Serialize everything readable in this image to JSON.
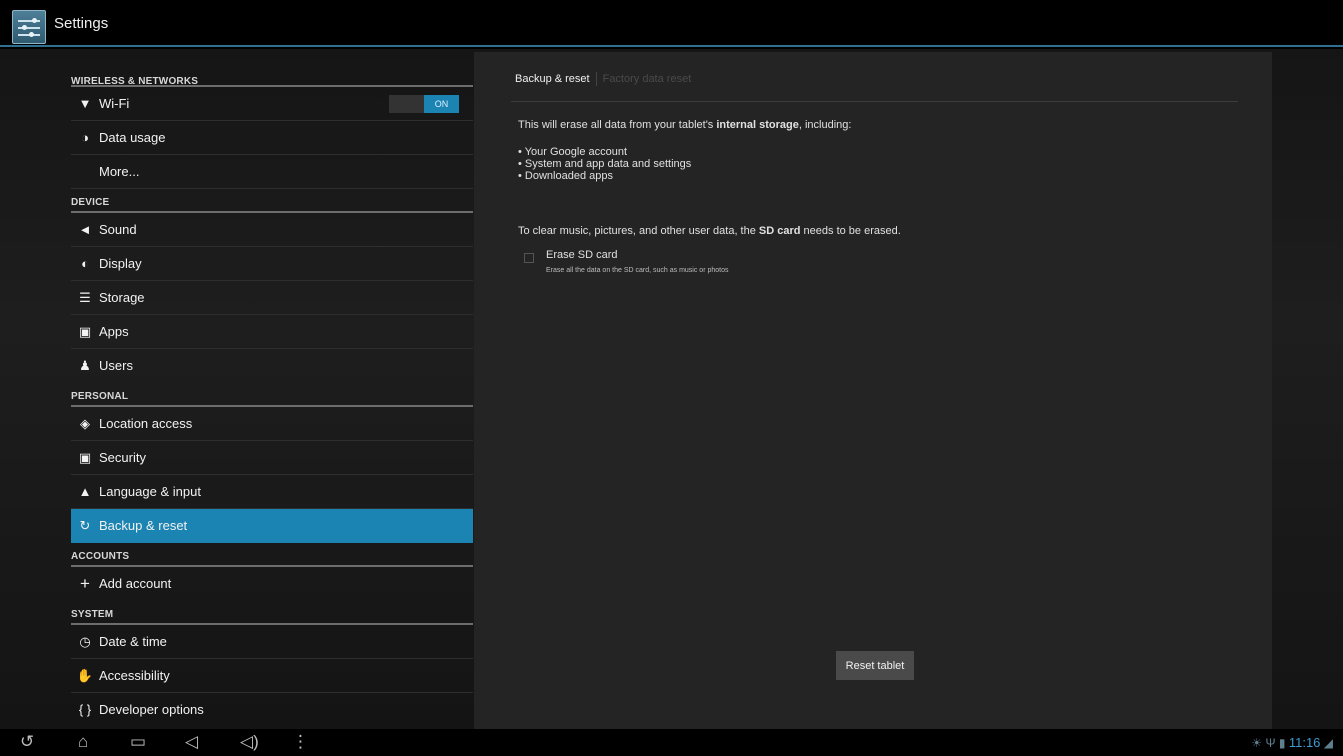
{
  "app": {
    "title": "Settings",
    "icon": "settings-sliders-icon"
  },
  "sidebar": {
    "sections": [
      {
        "header": "WIRELESS & NETWORKS",
        "items": [
          {
            "icon": "wifi-icon",
            "label": "Wi-Fi",
            "toggle": "ON"
          },
          {
            "icon": "data-usage-icon",
            "label": "Data usage"
          },
          {
            "icon": "",
            "label": "More..."
          }
        ]
      },
      {
        "header": "DEVICE",
        "items": [
          {
            "icon": "sound-icon",
            "label": "Sound"
          },
          {
            "icon": "display-icon",
            "label": "Display"
          },
          {
            "icon": "storage-icon",
            "label": "Storage"
          },
          {
            "icon": "apps-icon",
            "label": "Apps"
          },
          {
            "icon": "users-icon",
            "label": "Users"
          }
        ]
      },
      {
        "header": "PERSONAL",
        "items": [
          {
            "icon": "location-icon",
            "label": "Location access"
          },
          {
            "icon": "lock-icon",
            "label": "Security"
          },
          {
            "icon": "language-icon",
            "label": "Language & input"
          },
          {
            "icon": "backup-icon",
            "label": "Backup & reset",
            "selected": true
          }
        ]
      },
      {
        "header": "ACCOUNTS",
        "items": [
          {
            "icon": "add-icon",
            "label": "Add account"
          }
        ]
      },
      {
        "header": "SYSTEM",
        "items": [
          {
            "icon": "clock-icon",
            "label": "Date & time"
          },
          {
            "icon": "hand-icon",
            "label": "Accessibility"
          },
          {
            "icon": "braces-icon",
            "label": "Developer options"
          }
        ]
      }
    ]
  },
  "panel": {
    "breadcrumb": {
      "active": "Backup & reset",
      "inactive": "Factory data reset"
    },
    "description": {
      "before": "This will erase all data from your tablet's ",
      "bold": "internal storage",
      "after": ", including:"
    },
    "list": [
      "Your Google account",
      "System and app data and settings",
      "Downloaded apps"
    ],
    "sd_note": {
      "before": "To clear music, pictures, and other user data, the ",
      "bold": "SD card",
      "after": " needs to be erased."
    },
    "checkbox": {
      "label": "Erase SD card",
      "sublabel": "Erase all the data on the SD card, such as music or photos",
      "checked": false
    },
    "reset_button": "Reset tablet"
  },
  "navbar": {
    "buttons": [
      "back-icon",
      "home-icon",
      "recent-apps-icon",
      "volume-down-icon",
      "volume-up-icon",
      "menu-icon"
    ],
    "status": {
      "time": "11:16"
    }
  },
  "colors": {
    "accent": "#1b84b3",
    "background": "#000000",
    "panel": "#242424"
  }
}
